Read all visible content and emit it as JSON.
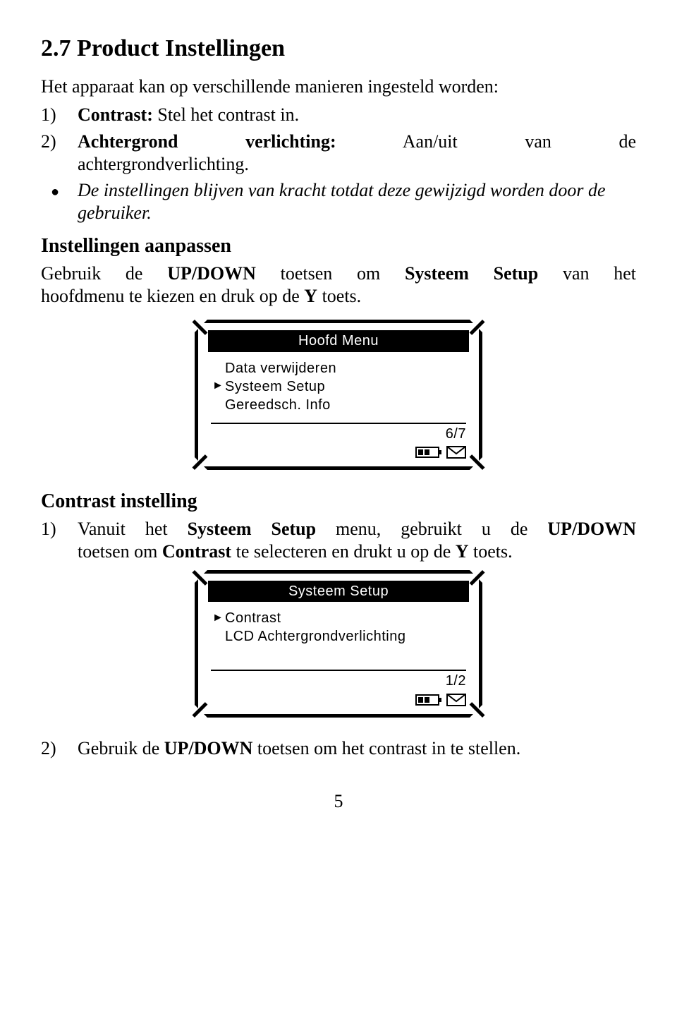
{
  "section": {
    "number": "2.7",
    "title": "Product Instellingen",
    "intro": "Het apparaat kan op verschillende manieren ingesteld worden:",
    "items": [
      {
        "n": "1)",
        "label": "Contrast:",
        "text": "Stel het contrast in."
      },
      {
        "n": "2)",
        "label_line1": "Achtergrond",
        "label_line1b": "verlichting:",
        "label_line1c": "Aan/uit",
        "label_line1d": "van",
        "label_line1e": "de",
        "line2": "achtergrondverlichting."
      }
    ],
    "bullet": "De instellingen blijven van kracht totdat deze gewijzigd worden door de gebruiker."
  },
  "adjust": {
    "heading": "Instellingen aanpassen",
    "para_l1a": "Gebruik de ",
    "para_l1b": "UP/DOWN",
    "para_l1c": " toetsen om ",
    "para_l1d": "Systeem Setup",
    "para_l1e": " van het",
    "para_l2a": "hoofdmenu te kiezen en druk op de ",
    "para_l2b": "Y",
    "para_l2c": " toets."
  },
  "lcd1": {
    "title": "Hoofd Menu",
    "items": [
      {
        "sel": false,
        "label": "Data verwijderen"
      },
      {
        "sel": true,
        "label": "Systeem Setup"
      },
      {
        "sel": false,
        "label": "Gereedsch. Info"
      }
    ],
    "page": "6/7"
  },
  "contrast": {
    "heading": "Contrast instelling",
    "l1_n": "1)",
    "l1a": "Vanuit het ",
    "l1b": "Systeem Setup",
    "l1c": " menu, gebruikt u de ",
    "l1d": "UP/DOWN",
    "l2a": "toetsen om ",
    "l2b": "Contrast",
    "l2c": " te selecteren en drukt u op de ",
    "l2d": "Y",
    "l2e": " toets."
  },
  "lcd2": {
    "title": "Systeem Setup",
    "items": [
      {
        "sel": true,
        "label": "Contrast"
      },
      {
        "sel": false,
        "label": "LCD Achtergrondverlichting"
      }
    ],
    "page": "1/2"
  },
  "final": {
    "n": "2)",
    "a": "Gebruik de ",
    "b": "UP/DOWN",
    "c": " toetsen om het contrast in te stellen."
  },
  "page_number": "5"
}
